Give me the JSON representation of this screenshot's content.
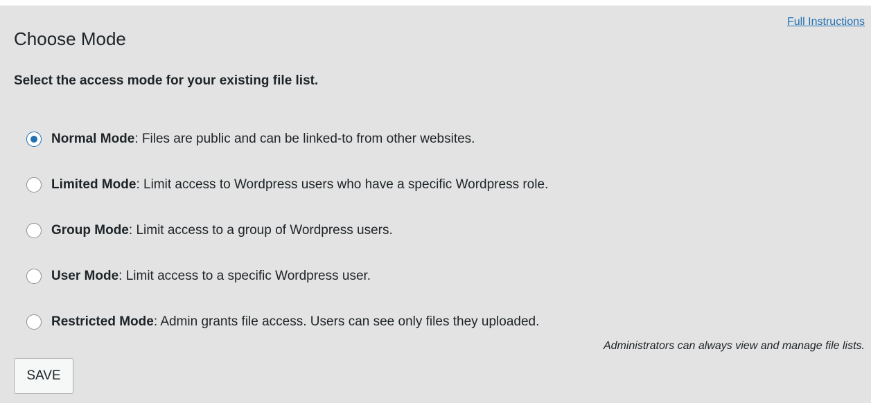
{
  "header": {
    "instructions_link": "Full Instructions",
    "title": "Choose Mode",
    "subtitle": "Select the access mode for your existing file list."
  },
  "modes": [
    {
      "name": "Normal Mode",
      "description": ": Files are public and can be linked-to from other websites.",
      "selected": true
    },
    {
      "name": "Limited Mode",
      "description": ": Limit access to Wordpress users who have a specific Wordpress role.",
      "selected": false
    },
    {
      "name": "Group Mode",
      "description": ": Limit access to a group of Wordpress users.",
      "selected": false
    },
    {
      "name": "User Mode",
      "description": ": Limit access to a specific Wordpress user.",
      "selected": false
    },
    {
      "name": "Restricted Mode",
      "description": ": Admin grants file access. Users can see only files they uploaded.",
      "selected": false
    }
  ],
  "footer": {
    "note": "Administrators can always view and manage file lists.",
    "save_label": "SAVE"
  },
  "colors": {
    "accent": "#2271b1",
    "panel_background": "#e3e3e3"
  }
}
